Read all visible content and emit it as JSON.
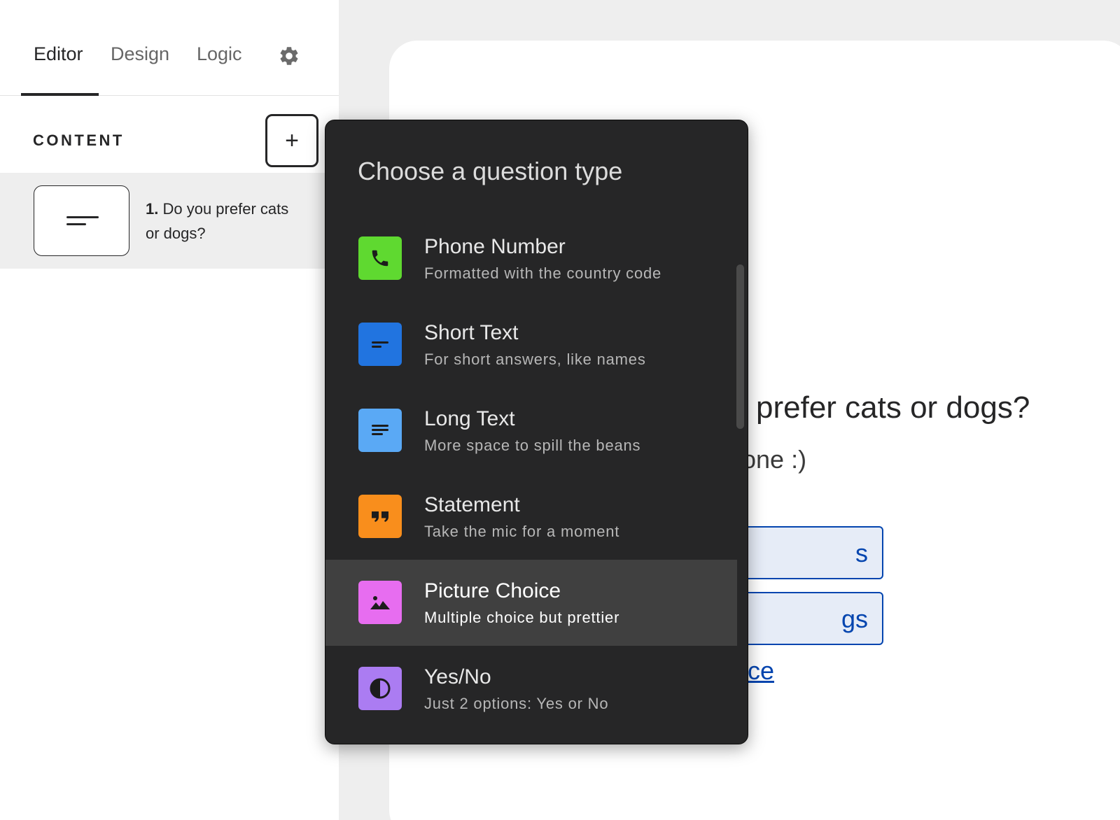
{
  "tabs": [
    {
      "label": "Editor",
      "active": true
    },
    {
      "label": "Design",
      "active": false
    },
    {
      "label": "Logic",
      "active": false
    }
  ],
  "settings_icon": "gear-icon",
  "content": {
    "label": "CONTENT",
    "add_label": "+",
    "questions": [
      {
        "number": "1.",
        "text": "Do you prefer cats or dogs?",
        "icon": "short-text-icon"
      }
    ]
  },
  "preview": {
    "title_partial": "prefer cats or dogs?",
    "subtitle_partial": "one :)",
    "choices": [
      "s",
      "gs"
    ],
    "link_partial": "ice",
    "link_color": "#0445af"
  },
  "dropdown": {
    "title": "Choose a question type",
    "items": [
      {
        "name": "Phone Number",
        "description": "Formatted with the country code",
        "icon": "phone-icon",
        "color": "#5fd930",
        "highlighted": false
      },
      {
        "name": "Short Text",
        "description": "For short answers, like names",
        "icon": "short-text-icon",
        "color": "#2174e0",
        "highlighted": false
      },
      {
        "name": "Long Text",
        "description": "More space to spill the beans",
        "icon": "long-text-icon",
        "color": "#5aa9f5",
        "highlighted": false
      },
      {
        "name": "Statement",
        "description": "Take the mic for a moment",
        "icon": "quote-icon",
        "color": "#f98e1c",
        "highlighted": false
      },
      {
        "name": "Picture Choice",
        "description": "Multiple choice but prettier",
        "icon": "image-icon",
        "color": "#e76df0",
        "highlighted": true
      },
      {
        "name": "Yes/No",
        "description": "Just 2 options: Yes or No",
        "icon": "yes-no-icon",
        "color": "#ab7cf2",
        "highlighted": false
      }
    ]
  }
}
